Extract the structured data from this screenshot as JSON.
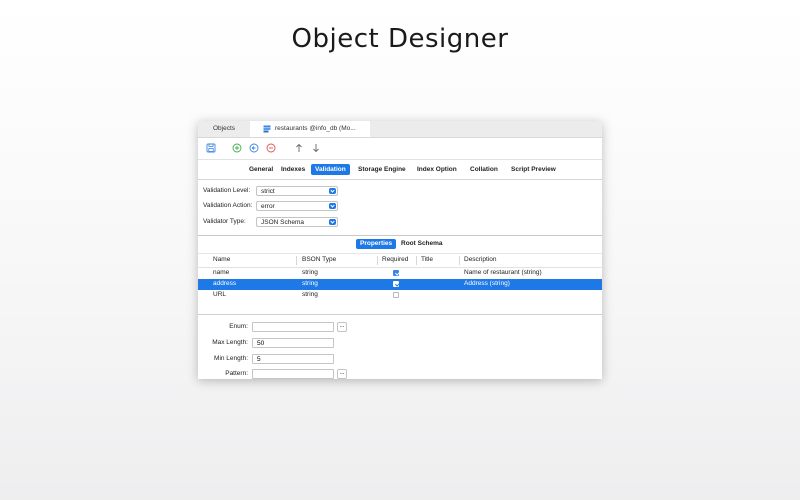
{
  "headline": "Object Designer",
  "tabs": {
    "objects": "Objects",
    "active": "restaurants @info_db (Mo..."
  },
  "subtabs": [
    "General",
    "Indexes",
    "Validation",
    "Storage Engine",
    "Index Option",
    "Collation",
    "Script Preview"
  ],
  "selected_subtab": "Validation",
  "validation": {
    "level_label": "Validation Level:",
    "level_value": "strict",
    "action_label": "Validation Action:",
    "action_value": "error",
    "type_label": "Validator Type:",
    "type_value": "JSON Schema"
  },
  "segments": {
    "properties": "Properties",
    "root_schema": "Root Schema"
  },
  "grid": {
    "headers": {
      "name": "Name",
      "bson_type": "BSON Type",
      "required": "Required",
      "title": "Title",
      "description": "Description"
    },
    "rows": [
      {
        "name": "name",
        "bson_type": "string",
        "required": true,
        "title": "",
        "description": "Name of restaurant (string)"
      },
      {
        "name": "address",
        "bson_type": "string",
        "required": true,
        "title": "",
        "description": "Address (string)"
      },
      {
        "name": "URL",
        "bson_type": "string",
        "required": false,
        "title": "",
        "description": ""
      }
    ],
    "selected_row": 1
  },
  "details": {
    "enum_label": "Enum:",
    "enum_value": "",
    "max_length_label": "Max Length:",
    "max_length_value": "50",
    "min_length_label": "Min Length:",
    "min_length_value": "5",
    "pattern_label": "Pattern:",
    "pattern_value": "",
    "ellipsis": "..."
  },
  "colors": {
    "accent": "#1e78e6",
    "add_green": "#3cb34a",
    "nav_blue": "#3a86e8",
    "remove_red": "#e05252"
  }
}
